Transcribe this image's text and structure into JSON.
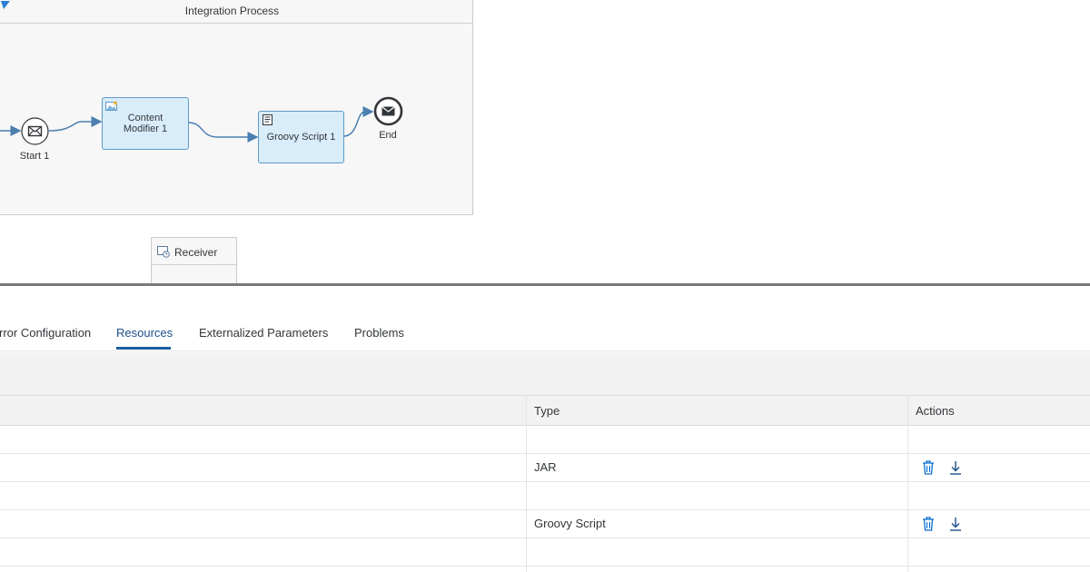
{
  "diagram": {
    "pool_title": "Integration Process",
    "start_event": {
      "label": "Start 1"
    },
    "content_modifier": {
      "label_line1": "Content",
      "label_line2": "Modifier 1"
    },
    "groovy_script": {
      "label": "Groovy Script 1"
    },
    "end_event": {
      "label": "End"
    },
    "receiver": {
      "label": "Receiver"
    }
  },
  "tabs": [
    {
      "label": "rror Configuration"
    },
    {
      "label": "Resources",
      "active": true
    },
    {
      "label": "Externalized Parameters"
    },
    {
      "label": "Problems"
    }
  ],
  "table": {
    "columns": {
      "type": "Type",
      "actions": "Actions"
    },
    "rows": [
      {
        "type": ""
      },
      {
        "type": "JAR"
      },
      {
        "type": ""
      },
      {
        "type": "Groovy Script"
      },
      {
        "type": ""
      }
    ]
  },
  "colors": {
    "accent": "#1b5fa5",
    "task_fill": "#d8ecfa",
    "task_border": "#5e9ac6",
    "flow_line": "#4a7fb0"
  },
  "icons": {
    "delete": "trash-icon",
    "download": "download-icon",
    "message": "envelope-icon",
    "script": "script-icon",
    "receiver": "receiver-system-icon"
  }
}
